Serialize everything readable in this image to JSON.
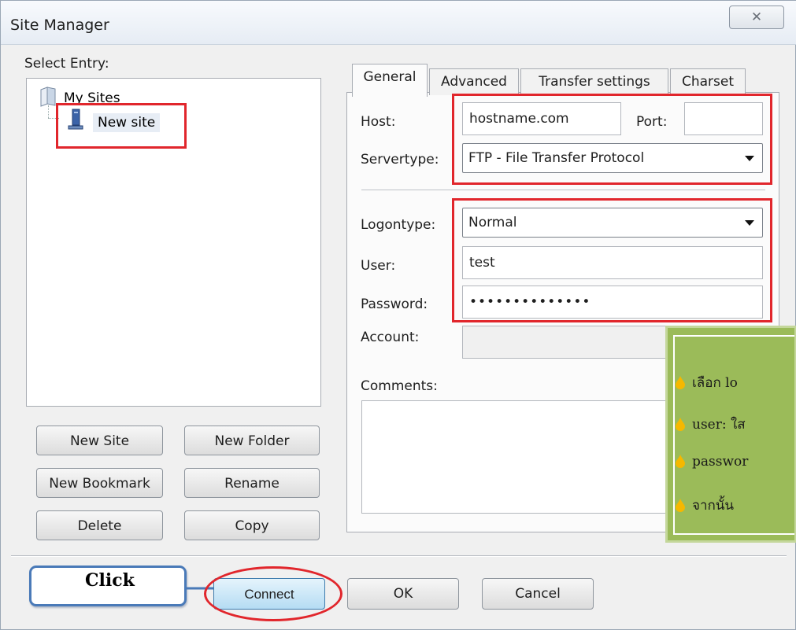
{
  "window": {
    "title": "Site Manager",
    "close_glyph": "✕"
  },
  "left": {
    "select_entry_label": "Select Entry:",
    "tree": {
      "root_label": "My Sites",
      "child_label": "New site"
    },
    "buttons": {
      "new_site": "New Site",
      "new_folder": "New Folder",
      "new_bookmark": "New Bookmark",
      "rename": "Rename",
      "delete": "Delete",
      "copy": "Copy"
    }
  },
  "tabs": [
    {
      "label": "General",
      "active": true
    },
    {
      "label": "Advanced"
    },
    {
      "label": "Transfer settings"
    },
    {
      "label": "Charset"
    }
  ],
  "form": {
    "host_label": "Host:",
    "host_value": "hostname.com",
    "port_label": "Port:",
    "port_value": "",
    "servertype_label": "Servertype:",
    "servertype_value": "FTP - File Transfer Protocol",
    "logontype_label": "Logontype:",
    "logontype_value": "Normal",
    "user_label": "User:",
    "user_value": "test",
    "password_label": "Password:",
    "password_value": "••••••••••••••",
    "account_label": "Account:",
    "account_value": "",
    "comments_label": "Comments:",
    "comments_value": ""
  },
  "bottom": {
    "connect": "Connect",
    "ok": "OK",
    "cancel": "Cancel"
  },
  "callout": {
    "text": "Click"
  },
  "note": {
    "lines": [
      "เลือก lo",
      "user: ใส",
      "passwor",
      "จากนั้น"
    ]
  },
  "colors": {
    "annotation_red": "#e1262c",
    "note_green": "#9bbb59",
    "note_bullet": "#f5b800",
    "callout_border": "#4a7ab8",
    "connect_button": "#b5dcf3"
  }
}
